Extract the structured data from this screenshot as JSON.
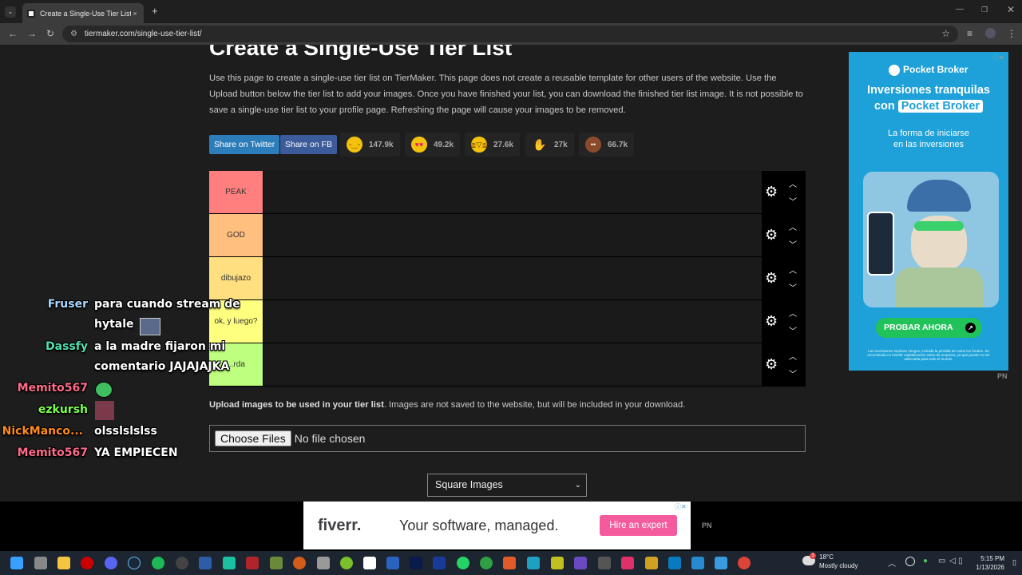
{
  "browser": {
    "tab_title": "Create a Single-Use Tier List (Pe",
    "url": "tiermaker.com/single-use-tier-list/",
    "new_tab": "+",
    "close_tab": "×"
  },
  "page": {
    "heading": "Create a Single-Use Tier List",
    "intro": "Use this page to create a single-use tier list on TierMaker. This page does not create a reusable template for other users of the website. Use the Upload button below the tier list to add your images. Once you have finished your list, you can download the finished tier list image. It is not possible to save a single-use tier list to your profile page. Refreshing the page will cause your images to be removed.",
    "share_twitter": "Share on Twitter",
    "share_fb": "Share on FB",
    "reactions": [
      {
        "icon": "grin-emoji-icon",
        "count": "147.9k"
      },
      {
        "icon": "heart-eyes-emoji-icon",
        "count": "49.2k"
      },
      {
        "icon": "laughing-emoji-icon",
        "count": "27.6k"
      },
      {
        "icon": "raised-hands-emoji-icon",
        "count": "27k"
      },
      {
        "icon": "poop-emoji-icon",
        "count": "66.7k"
      }
    ],
    "tiers": [
      {
        "label": "PEAK",
        "color": "#ff7f7f"
      },
      {
        "label": "GOD",
        "color": "#ffbf7f"
      },
      {
        "label": "dibujazo",
        "color": "#ffdf7f"
      },
      {
        "label": "ok, y luego?",
        "color": "#ffff7f"
      },
      {
        "label": "...rda",
        "color": "#bfff7f"
      }
    ],
    "upload_bold": "Upload images to be used in your tier list",
    "upload_rest": ". Images are not saved to the website, but will be included in your download.",
    "file_button": "Choose Files",
    "file_status": "No file chosen",
    "image_shape": "Square Images"
  },
  "side_ad": {
    "brand": "Pocket Broker",
    "headline1": "Inversiones tranquilas",
    "headline2_pre": "con",
    "headline2_hl": "Pocket Broker",
    "sub1": "La forma de iniciarse",
    "sub2": "en las inversiones",
    "cta": "PROBAR AHORA",
    "fine": "Las inversiones implican riesgos, incluida la pérdida de todos los fondos. Se recomienda no invertir capitalización antes de empezar, ya que puede no ser adecuada para todo el mundo.",
    "pn": "PN"
  },
  "bottom_ad": {
    "brand": "fiverr.",
    "message": "Your software, managed.",
    "cta": "Hire an expert",
    "pn": "PN"
  },
  "chat": [
    {
      "user": "Fruser",
      "color": "#a8d8ff",
      "lines": [
        "para cuando stream de",
        "hytale"
      ]
    },
    {
      "user": "Dassfy",
      "color": "#4fe0b0",
      "lines": [
        "a la madre fijaron mi",
        "comentario JAJAJAJKA"
      ]
    },
    {
      "user": "Memito567",
      "color": "#ff6b8a",
      "lines": [
        ""
      ]
    },
    {
      "user": "ezkursh",
      "color": "#7cff4f",
      "lines": [
        ""
      ]
    },
    {
      "user": "NickManco...",
      "color": "#ff8c1a",
      "lines": [
        "olsslslslss"
      ]
    },
    {
      "user": "Memito567",
      "color": "#ff6b8a",
      "lines": [
        "YA EMPIECEN"
      ]
    }
  ],
  "taskbar": {
    "temp": "18°C",
    "weather": "Mostly cloudy",
    "time": "5:15 PM",
    "date": "1/13/2026",
    "badge": "3"
  }
}
